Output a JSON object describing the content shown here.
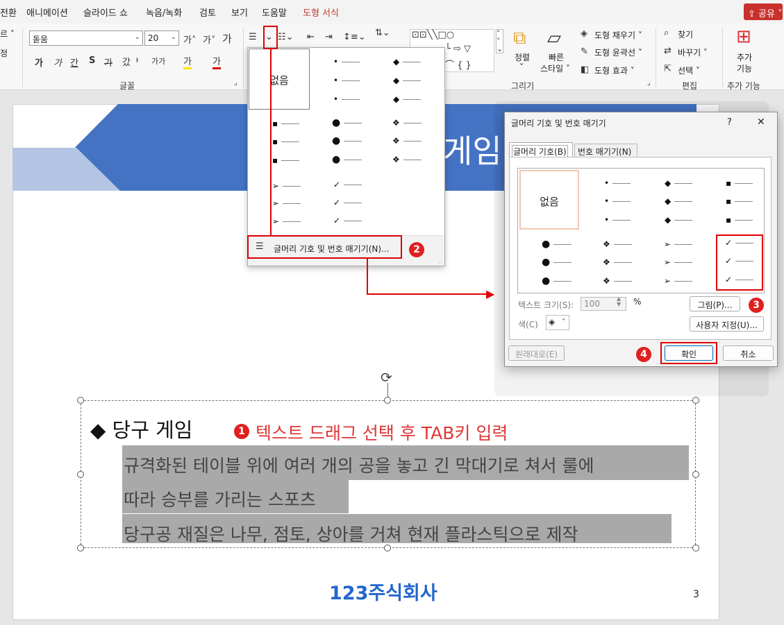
{
  "menubar": {
    "items": [
      "전환",
      "애니메이션",
      "슬라이드 쇼",
      "녹음/녹화",
      "검토",
      "보기",
      "도움말",
      "도형 서식"
    ],
    "share": "공유"
  },
  "ribbon": {
    "left_partial": [
      "르 ˅",
      "정"
    ],
    "font_name": "돋움",
    "font_size": "20",
    "font_grow": "가˄",
    "font_shrink": "가˅",
    "clear_format": "가",
    "bold": "가",
    "italic": "가",
    "underline": "간",
    "shadow": "S",
    "strike": "가",
    "spacing": "갔ᅡ",
    "case": "가가",
    "highlight": "가",
    "font_color": "가",
    "font_group": "글꼴",
    "drawing": {
      "arrange": "정렬",
      "quick_styles": "빠른\n스타일",
      "quick_styles_l1": "빠른",
      "quick_styles_l2": "스타일 ˅",
      "fill": "도형 채우기 ˅",
      "outline": "도형 윤곽선 ˅",
      "effects": "도형 효과 ˅",
      "group": "그리기"
    },
    "edit": {
      "find": "찾기",
      "replace": "바꾸기 ˅",
      "select": "선택 ˅",
      "group": "편집"
    },
    "addins": {
      "label_l1": "추가",
      "label_l2": "기능",
      "group": "추가 기능"
    }
  },
  "bullet_dropdown": {
    "none": "없음",
    "footer_item": "글머리 기호 및 번호 매기기(N)..."
  },
  "slide": {
    "banner_title": "게임",
    "heading": "◆ 당구 게임",
    "step1_note": "텍스트 드래그 선택 후 TAB키 입력",
    "body_lines": [
      "규격화된 테이블 위에 여러 개의 공을 놓고 긴 막대기로 쳐서 룰에",
      "따라 승부를 가리는 스포츠",
      "당구공 재질은 나무, 점토, 상아를 거쳐 현재 플라스틱으로 제작"
    ],
    "logo": "123주식회사",
    "page_number": "3"
  },
  "dialog": {
    "title": "글머리 기호 및 번호 매기기",
    "help": "?",
    "close": "✕",
    "tab_bullets": "글머리 기호(B)",
    "tab_numbering": "번호 매기기(N)",
    "none": "없음",
    "size_label": "텍스트 크기(S):",
    "size_value": "100",
    "percent": "%",
    "color_label": "색(C)",
    "picture_button": "그림(P)...",
    "customize_button": "사용자 지정(U)...",
    "reset_button": "원래대로(E)",
    "ok_button": "확인",
    "cancel_button": "취소"
  },
  "steps": [
    "1",
    "2",
    "3",
    "4"
  ],
  "colors": {
    "accent_red": "#dd0000",
    "banner_blue": "#4573c4",
    "selection_gray": "#a9a9a9"
  }
}
